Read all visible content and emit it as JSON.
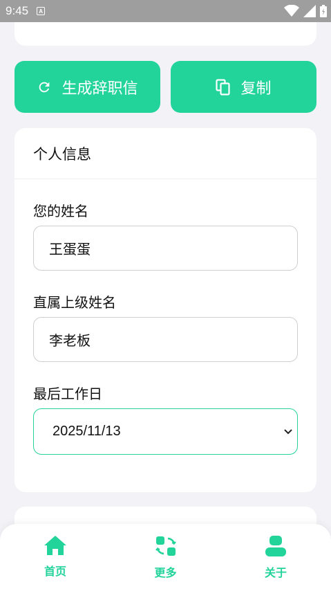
{
  "status_bar": {
    "time": "9:45",
    "notif_letter": "A"
  },
  "actions": {
    "generate_label": "生成辞职信",
    "copy_label": "复制"
  },
  "personal_info": {
    "title": "个人信息",
    "name_label": "您的姓名",
    "name_value": "王蛋蛋",
    "boss_label": "直属上级姓名",
    "boss_value": "李老板",
    "last_day_label": "最后工作日",
    "last_day_value": "2025/11/13"
  },
  "tabs": [
    {
      "label": "首页",
      "icon": "home-icon"
    },
    {
      "label": "更多",
      "icon": "more-icon"
    },
    {
      "label": "关于",
      "icon": "user-icon"
    }
  ],
  "colors": {
    "accent": "#22d39a",
    "background": "#f3f3f7"
  }
}
